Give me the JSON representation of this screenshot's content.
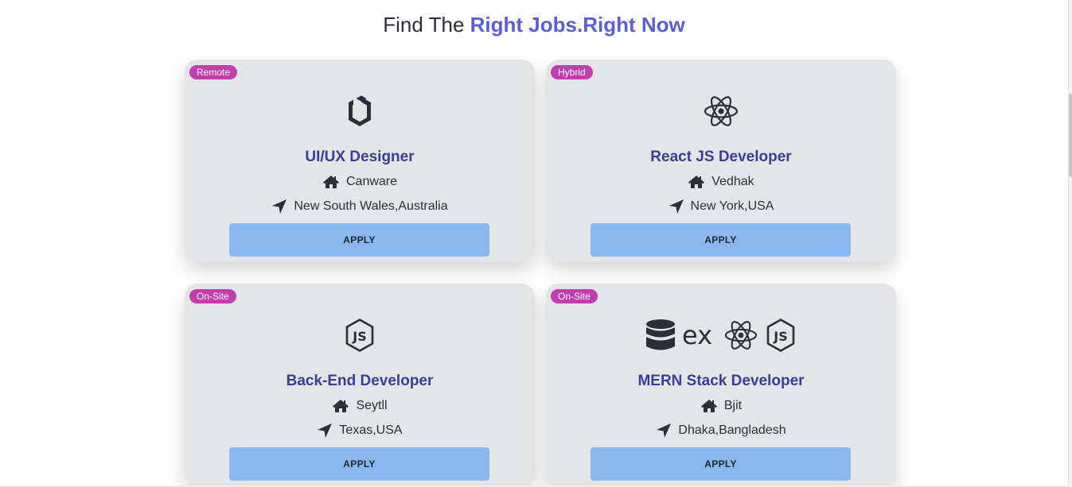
{
  "header": {
    "title_prefix": "Find The",
    "title_accent": "Right Jobs.Right Now"
  },
  "colors": {
    "accent": "#5a5fd6",
    "job_title": "#3b3d9e",
    "badge": "#c13db0",
    "apply_button": "#88b8ef",
    "card_bg": "#e4e5e6"
  },
  "jobs": [
    {
      "badge": "Remote",
      "logo": "uikit-icon",
      "title": "UI/UX Designer",
      "company": "Canware",
      "location": "New South Wales,Australia",
      "apply_label": "APPLY"
    },
    {
      "badge": "Hybrid",
      "logo": "react-icon",
      "title": "React JS Developer",
      "company": "Vedhak",
      "location": "New York,USA",
      "apply_label": "APPLY"
    },
    {
      "badge": "On-Site",
      "logo": "nodejs-icon",
      "title": "Back-End Developer",
      "company": "Seytll",
      "location": "Texas,USA",
      "apply_label": "APPLY"
    },
    {
      "badge": "On-Site",
      "logo": "mern-icons",
      "title": "MERN Stack Developer",
      "company": "Bjit",
      "location": "Dhaka,Bangladesh",
      "apply_label": "APPLY"
    }
  ],
  "icons": {
    "company": "home-icon",
    "location": "location-arrow-icon"
  }
}
